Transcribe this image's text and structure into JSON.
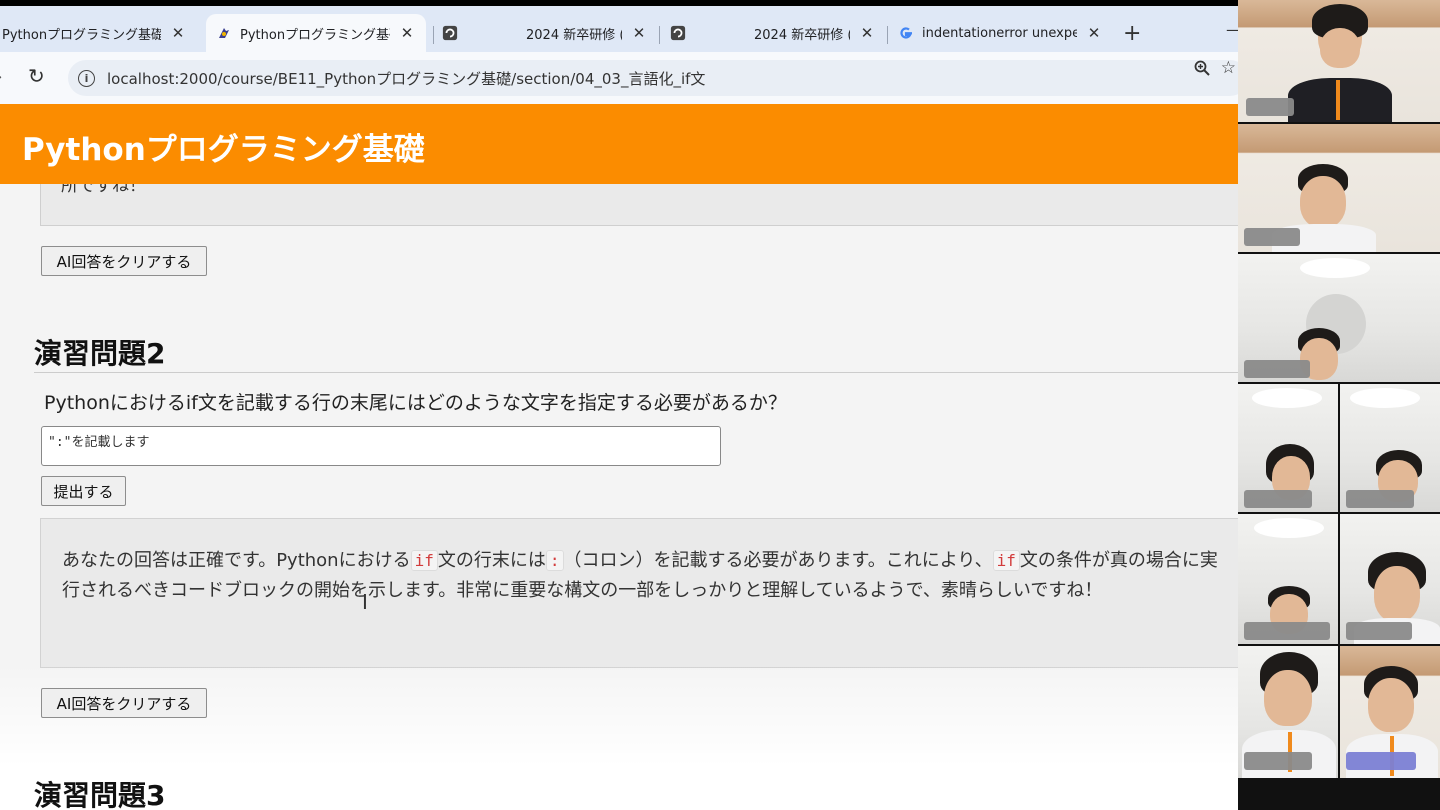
{
  "browser": {
    "tabs": [
      {
        "title": "Pythonプログラミング基礎",
        "favicon": "python-icon",
        "close": "✕",
        "active": false
      },
      {
        "title": "Pythonプログラミング基礎",
        "favicon": "python-icon",
        "close": "✕",
        "active": true
      },
      {
        "title": "2024 新卒研修 (",
        "favicon": "app-icon",
        "close": "✕",
        "active": false
      },
      {
        "title": "2024 新卒研修 (",
        "favicon": "app-icon",
        "close": "✕",
        "active": false
      },
      {
        "title": "indentationerror unexpec",
        "favicon": "google-icon",
        "close": "✕",
        "active": false
      }
    ],
    "new_tab": "+",
    "url": "localhost:2000/course/BE11_Pythonプログラミング基礎/section/04_03_言語化_if文"
  },
  "site": {
    "title": "Pythonプログラミング基礎",
    "accent_color": "#fb8c00"
  },
  "page": {
    "prev_answer_tail": "所ですね！",
    "clear_button_1": "AI回答をクリアする",
    "exercise2": {
      "heading": "演習問題2",
      "question": "Pythonにおけるif文を記載する行の末尾にはどのような文字を指定する必要があるか？",
      "answer_value": "\":\"を記載します",
      "submit_label": "提出する",
      "response": {
        "p1": "あなたの回答は正確です。Pythonにおける",
        "code1": "if",
        "p2": "文の行末には",
        "code2": ":",
        "p3": "（コロン）を記載する必要があります。これにより、",
        "code3": "if",
        "p4": "文の条件が真の場合に実行されるべきコードブロックの開始を示します。非常に重要な構文の一部をしっかりと理解しているようで、素晴らしいですね！"
      }
    },
    "clear_button_2": "AI回答をクリアする",
    "exercise3_heading": "演習問題3"
  },
  "video_call": {
    "participant_count": 9
  }
}
